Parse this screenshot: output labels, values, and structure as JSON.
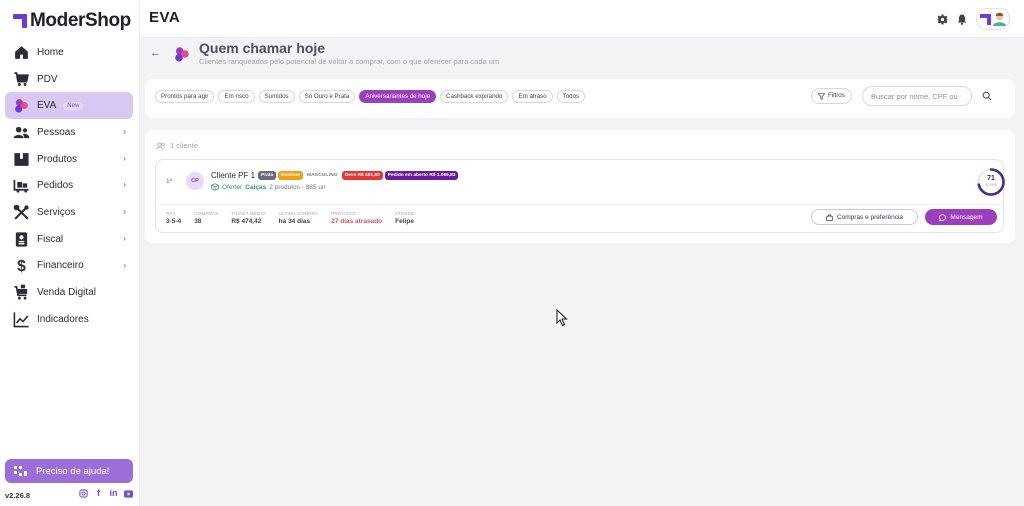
{
  "brand": {
    "name": "ModerShop"
  },
  "sidebar": {
    "items": [
      {
        "label": "Home",
        "icon": "home-icon"
      },
      {
        "label": "PDV",
        "icon": "cart-icon"
      },
      {
        "label": "EVA",
        "icon": "eva-icon",
        "badge": "New",
        "active": true
      },
      {
        "label": "Pessoas",
        "icon": "people-icon",
        "chevron": "›"
      },
      {
        "label": "Produtos",
        "icon": "box-icon",
        "chevron": "›"
      },
      {
        "label": "Pedidos",
        "icon": "truck-icon",
        "chevron": "›"
      },
      {
        "label": "Serviços",
        "icon": "tools-icon",
        "chevron": "›"
      },
      {
        "label": "Fiscal",
        "icon": "fiscal-icon",
        "chevron": "›"
      },
      {
        "label": "Financeiro",
        "icon": "dollar-icon",
        "chevron": "›"
      },
      {
        "label": "Venda Digital",
        "icon": "digital-cart-icon"
      },
      {
        "label": "Indicadores",
        "icon": "chart-icon"
      }
    ],
    "help_label": "Preciso de ajuda!",
    "version": "v2.26.8",
    "socials": [
      "instagram-icon",
      "facebook-icon",
      "linkedin-icon",
      "youtube-icon"
    ]
  },
  "topbar": {
    "title": "EVA"
  },
  "page": {
    "title": "Quem chamar hoje",
    "subtitle": "Clientes ranqueados pelo potencial de voltar a comprar, com o que oferecer para cada um"
  },
  "filters": {
    "chips": [
      {
        "label": "Prontos para agir"
      },
      {
        "label": "Em risco"
      },
      {
        "label": "Sumidos"
      },
      {
        "label": "Só Ouro e Prata"
      },
      {
        "label": "Aniversariantes de hoje",
        "active": true
      },
      {
        "label": "Cashback expirando"
      },
      {
        "label": "Em atraso"
      },
      {
        "label": "Todos"
      }
    ],
    "filters_label": "Filtros",
    "search_placeholder": "Buscar por nome, CPF ou"
  },
  "results": {
    "count_label": "1 cliente",
    "client": {
      "rank": "1º",
      "initials": "CP",
      "name": "Cliente PF 1",
      "tags": [
        {
          "label": "Prata",
          "color": "#6b6b7e"
        },
        {
          "label": "Reativar",
          "color": "#f0a018"
        },
        {
          "label": "MASCULINO",
          "plain": true
        },
        {
          "label": "Deve R$ 451,80",
          "color": "#e53935"
        },
        {
          "label": "Pedido em aberto R$ 1.069,83",
          "color": "#6a1b9a"
        }
      ],
      "offer_label": "Oferter",
      "offer_value": "Calças",
      "offer_detail": "2 produtos · 885 un",
      "score": 71,
      "score_label": "SCORE",
      "metrics": [
        {
          "label": "RFV",
          "value": "3-5-4"
        },
        {
          "label": "COMPRAS",
          "value": "38"
        },
        {
          "label": "TICKET MÉDIO",
          "value": "R$ 474,42"
        },
        {
          "label": "ÚLTIMA COMPRA",
          "value": "há 34 dias"
        },
        {
          "label": "PREVISÃO",
          "value": "27 dias atrasado",
          "alert": true
        },
        {
          "label": "ATENDE",
          "value": "Felipe"
        }
      ],
      "btn_history": "Compras e preferência",
      "btn_message": "Mensagem"
    }
  },
  "colors": {
    "accent": "#9b3fbf",
    "brand": "#6c3ad6",
    "active_bg": "#d9c8f3"
  }
}
